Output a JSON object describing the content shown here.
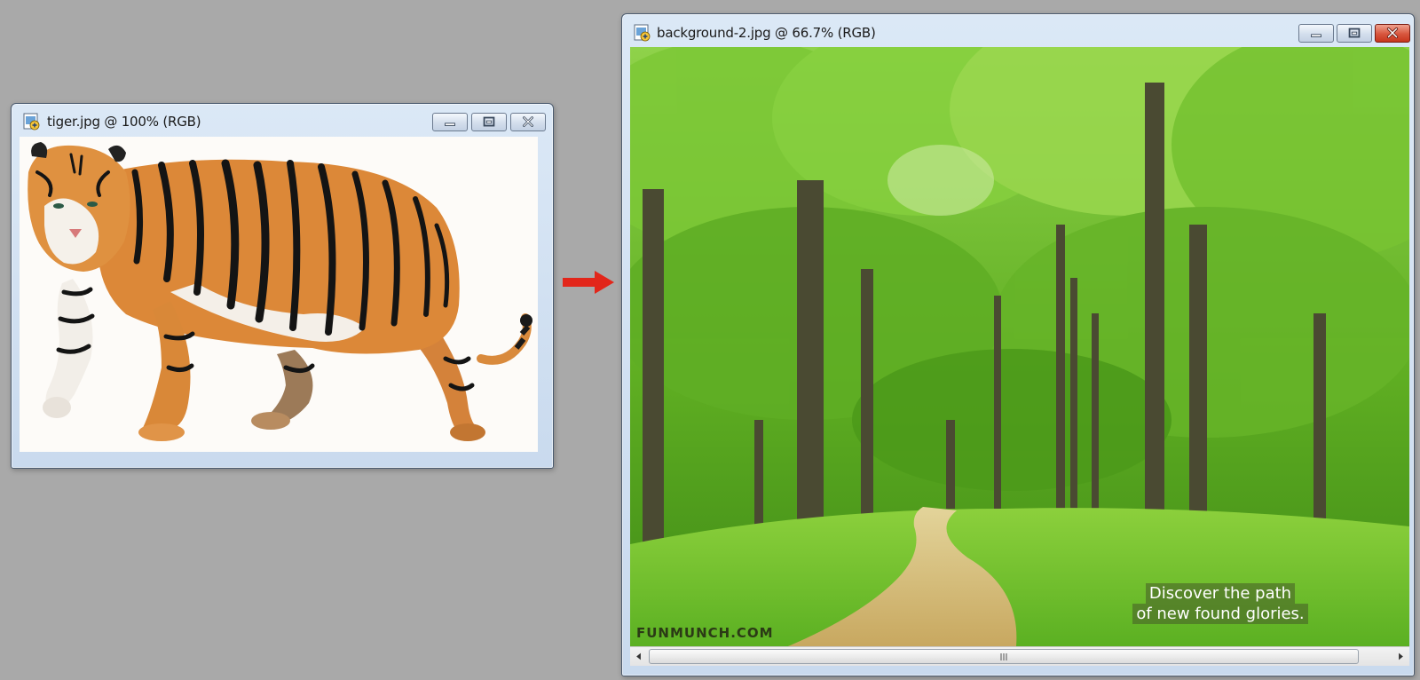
{
  "tiger_window": {
    "title": "tiger.jpg @ 100% (RGB)",
    "image": "tiger",
    "buttons": [
      "minimize-icon",
      "maximize-icon",
      "close-icon"
    ]
  },
  "arrow": {
    "color": "#e2261a"
  },
  "background_window": {
    "title": "background-2.jpg @ 66.7% (RGB)",
    "image": "forest-path",
    "watermark": "FUNMUNCH.COM",
    "tagline": [
      "Discover the path",
      "of new found glories."
    ],
    "buttons": [
      "minimize-icon",
      "maximize-icon",
      "close-icon"
    ],
    "scrollbar": {
      "orientation": "horizontal",
      "grip": "|||"
    }
  },
  "colors": {
    "desktop": "#a9a9a9",
    "titlebar": "#d6e4f3",
    "close_button": "#d04a33",
    "forest_green": "#5aa61e"
  }
}
